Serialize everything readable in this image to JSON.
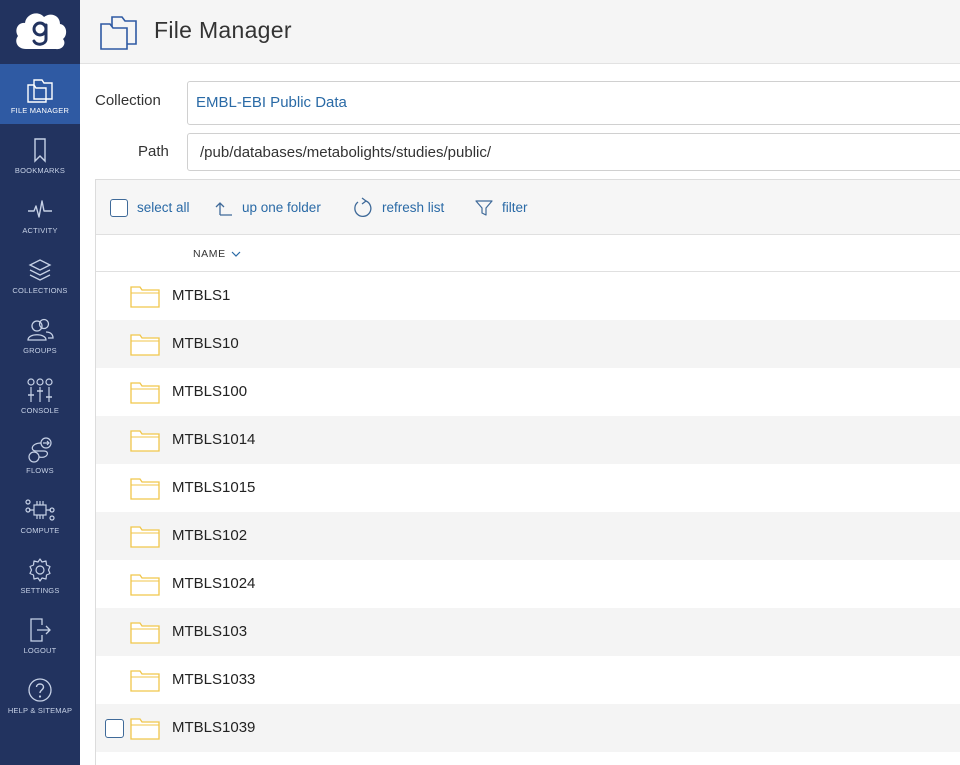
{
  "app": {
    "title": "File Manager"
  },
  "sidebar": {
    "items": [
      {
        "label": "FILE MANAGER",
        "icon": "file-manager-icon",
        "active": true
      },
      {
        "label": "BOOKMARKS",
        "icon": "bookmark-icon"
      },
      {
        "label": "ACTIVITY",
        "icon": "activity-icon"
      },
      {
        "label": "COLLECTIONS",
        "icon": "collections-icon"
      },
      {
        "label": "GROUPS",
        "icon": "groups-icon"
      },
      {
        "label": "CONSOLE",
        "icon": "console-icon"
      },
      {
        "label": "FLOWS",
        "icon": "flows-icon"
      },
      {
        "label": "COMPUTE",
        "icon": "compute-icon"
      },
      {
        "label": "SETTINGS",
        "icon": "gear-icon"
      },
      {
        "label": "LOGOUT",
        "icon": "logout-icon"
      },
      {
        "label": "HELP & SITEMAP",
        "icon": "help-icon"
      }
    ]
  },
  "form": {
    "collection_label": "Collection",
    "collection_value": "EMBL-EBI Public Data",
    "path_label": "Path",
    "path_value": "/pub/databases/metabolights/studies/public/"
  },
  "toolbar": {
    "select_all": "select all",
    "up_one_folder": "up one folder",
    "refresh_list": "refresh list",
    "filter": "filter"
  },
  "table": {
    "name_header": "NAME",
    "rows": [
      {
        "name": "MTBLS1"
      },
      {
        "name": "MTBLS10"
      },
      {
        "name": "MTBLS100"
      },
      {
        "name": "MTBLS1014"
      },
      {
        "name": "MTBLS1015"
      },
      {
        "name": "MTBLS102"
      },
      {
        "name": "MTBLS1024"
      },
      {
        "name": "MTBLS103"
      },
      {
        "name": "MTBLS1033"
      },
      {
        "name": "MTBLS1039",
        "checkbox_visible": true
      },
      {
        "name": ""
      }
    ]
  },
  "colors": {
    "sidebar_bg": "#22335f",
    "sidebar_active": "#2f5aa3",
    "link_blue": "#2a6aa6",
    "folder_yellow": "#f0c64a"
  }
}
